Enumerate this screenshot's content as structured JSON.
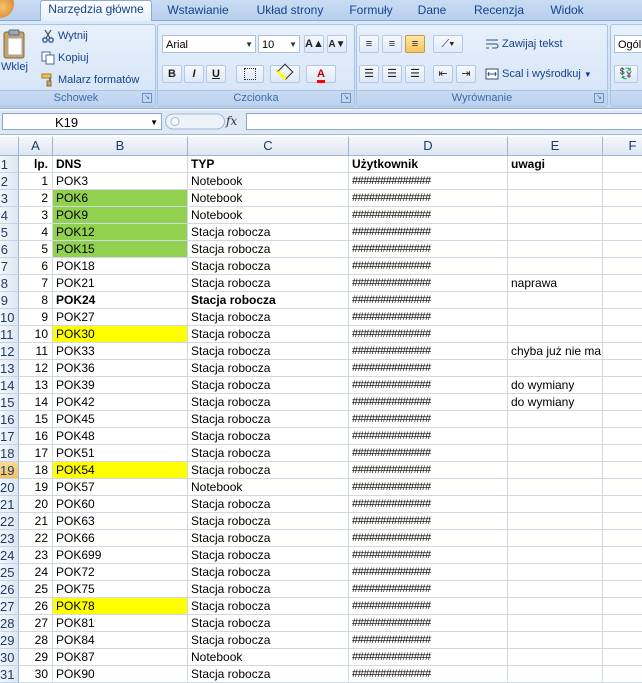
{
  "ribbon": {
    "tabs": [
      "Narzędzia główne",
      "Wstawianie",
      "Układ strony",
      "Formuły",
      "Dane",
      "Recenzja",
      "Widok"
    ],
    "active_tab": 0,
    "clipboard": {
      "paste_label": "Wklej",
      "cut_label": "Wytnij",
      "copy_label": "Kopiuj",
      "painter_label": "Malarz formatów",
      "group_label": "Schowek"
    },
    "font": {
      "font_name": "Arial",
      "font_size": "10",
      "grow_label": "A",
      "shrink_label": "A",
      "bold_label": "B",
      "italic_label": "I",
      "underline_label": "U",
      "color_label": "A",
      "group_label": "Czcionka"
    },
    "alignment": {
      "wrap_label": "Zawijaj tekst",
      "merge_label": "Scal i wyśrodkuj",
      "group_label": "Wyrównanie"
    },
    "number": {
      "format_label": "Ogól"
    }
  },
  "formula_bar": {
    "name_box": "K19",
    "fx_label": "fx",
    "formula": ""
  },
  "sheet": {
    "columns": [
      "A",
      "B",
      "C",
      "D",
      "E",
      "F"
    ],
    "row_numbers": [
      "1",
      "2",
      "3",
      "4",
      "5",
      "6",
      "7",
      "8",
      "9",
      "10",
      "11",
      "12",
      "13",
      "14",
      "15",
      "16",
      "17",
      "18",
      "19",
      "20",
      "21",
      "22",
      "23",
      "24",
      "25",
      "26",
      "27",
      "28",
      "29",
      "30",
      "31"
    ],
    "selected_row": "19",
    "header": {
      "lp": "lp.",
      "dns": "DNS",
      "typ": "TYP",
      "user": "Użytkownik",
      "notes": "uwagi"
    },
    "rows": [
      {
        "lp": "1",
        "dns": "POK3",
        "typ": "Notebook",
        "user": "##############",
        "notes": "",
        "hl": ""
      },
      {
        "lp": "2",
        "dns": "POK6",
        "typ": "Notebook",
        "user": "##############",
        "notes": "",
        "hl": "green"
      },
      {
        "lp": "3",
        "dns": "POK9",
        "typ": "Notebook",
        "user": "##############",
        "notes": "",
        "hl": "green"
      },
      {
        "lp": "4",
        "dns": "POK12",
        "typ": "Stacja robocza",
        "user": "##############",
        "notes": "",
        "hl": "green"
      },
      {
        "lp": "5",
        "dns": "POK15",
        "typ": "Stacja robocza",
        "user": "##############",
        "notes": "",
        "hl": "green"
      },
      {
        "lp": "6",
        "dns": "POK18",
        "typ": "Stacja robocza",
        "user": "##############",
        "notes": "",
        "hl": ""
      },
      {
        "lp": "7",
        "dns": "POK21",
        "typ": "Stacja robocza",
        "user": "##############",
        "notes": "naprawa",
        "hl": ""
      },
      {
        "lp": "8",
        "dns": "POK24",
        "typ": "Stacja robocza",
        "user": "##############",
        "notes": "",
        "hl": "",
        "bold": true
      },
      {
        "lp": "9",
        "dns": "POK27",
        "typ": "Stacja robocza",
        "user": "##############",
        "notes": "",
        "hl": ""
      },
      {
        "lp": "10",
        "dns": "POK30",
        "typ": "Stacja robocza",
        "user": "##############",
        "notes": "",
        "hl": "yellow"
      },
      {
        "lp": "11",
        "dns": "POK33",
        "typ": "Stacja robocza",
        "user": "##############",
        "notes": "chyba już nie ma",
        "hl": ""
      },
      {
        "lp": "12",
        "dns": "POK36",
        "typ": "Stacja robocza",
        "user": "##############",
        "notes": "",
        "hl": ""
      },
      {
        "lp": "13",
        "dns": "POK39",
        "typ": "Stacja robocza",
        "user": "##############",
        "notes": "do wymiany",
        "hl": ""
      },
      {
        "lp": "14",
        "dns": "POK42",
        "typ": "Stacja robocza",
        "user": "##############",
        "notes": "do wymiany",
        "hl": ""
      },
      {
        "lp": "15",
        "dns": "POK45",
        "typ": "Stacja robocza",
        "user": "##############",
        "notes": "",
        "hl": ""
      },
      {
        "lp": "16",
        "dns": "POK48",
        "typ": "Stacja robocza",
        "user": "##############",
        "notes": "",
        "hl": ""
      },
      {
        "lp": "17",
        "dns": "POK51",
        "typ": "Stacja robocza",
        "user": "##############",
        "notes": "",
        "hl": ""
      },
      {
        "lp": "18",
        "dns": "POK54",
        "typ": "Stacja robocza",
        "user": "##############",
        "notes": "",
        "hl": "yellow"
      },
      {
        "lp": "19",
        "dns": "POK57",
        "typ": "Notebook",
        "user": "##############",
        "notes": "",
        "hl": ""
      },
      {
        "lp": "20",
        "dns": "POK60",
        "typ": "Stacja robocza",
        "user": "##############",
        "notes": "",
        "hl": ""
      },
      {
        "lp": "21",
        "dns": "POK63",
        "typ": "Stacja robocza",
        "user": "##############",
        "notes": "",
        "hl": ""
      },
      {
        "lp": "22",
        "dns": "POK66",
        "typ": "Stacja robocza",
        "user": "##############",
        "notes": "",
        "hl": ""
      },
      {
        "lp": "23",
        "dns": "POK699",
        "typ": "Stacja robocza",
        "user": "##############",
        "notes": "",
        "hl": ""
      },
      {
        "lp": "24",
        "dns": "POK72",
        "typ": "Stacja robocza",
        "user": "##############",
        "notes": "",
        "hl": ""
      },
      {
        "lp": "25",
        "dns": "POK75",
        "typ": "Stacja robocza",
        "user": "##############",
        "notes": "",
        "hl": ""
      },
      {
        "lp": "26",
        "dns": "POK78",
        "typ": "Stacja robocza",
        "user": "##############",
        "notes": "",
        "hl": "yellow"
      },
      {
        "lp": "27",
        "dns": "POK81",
        "typ": "Stacja robocza",
        "user": "##############",
        "notes": "",
        "hl": ""
      },
      {
        "lp": "28",
        "dns": "POK84",
        "typ": "Stacja robocza",
        "user": "##############",
        "notes": "",
        "hl": ""
      },
      {
        "lp": "29",
        "dns": "POK87",
        "typ": "Notebook",
        "user": "##############",
        "notes": "",
        "hl": ""
      },
      {
        "lp": "30",
        "dns": "POK90",
        "typ": "Stacja robocza",
        "user": "##############",
        "notes": "",
        "hl": ""
      }
    ],
    "colors": {
      "green": "#92d050",
      "yellow": "#ffff00",
      "selected_header": "#f3c063"
    }
  }
}
